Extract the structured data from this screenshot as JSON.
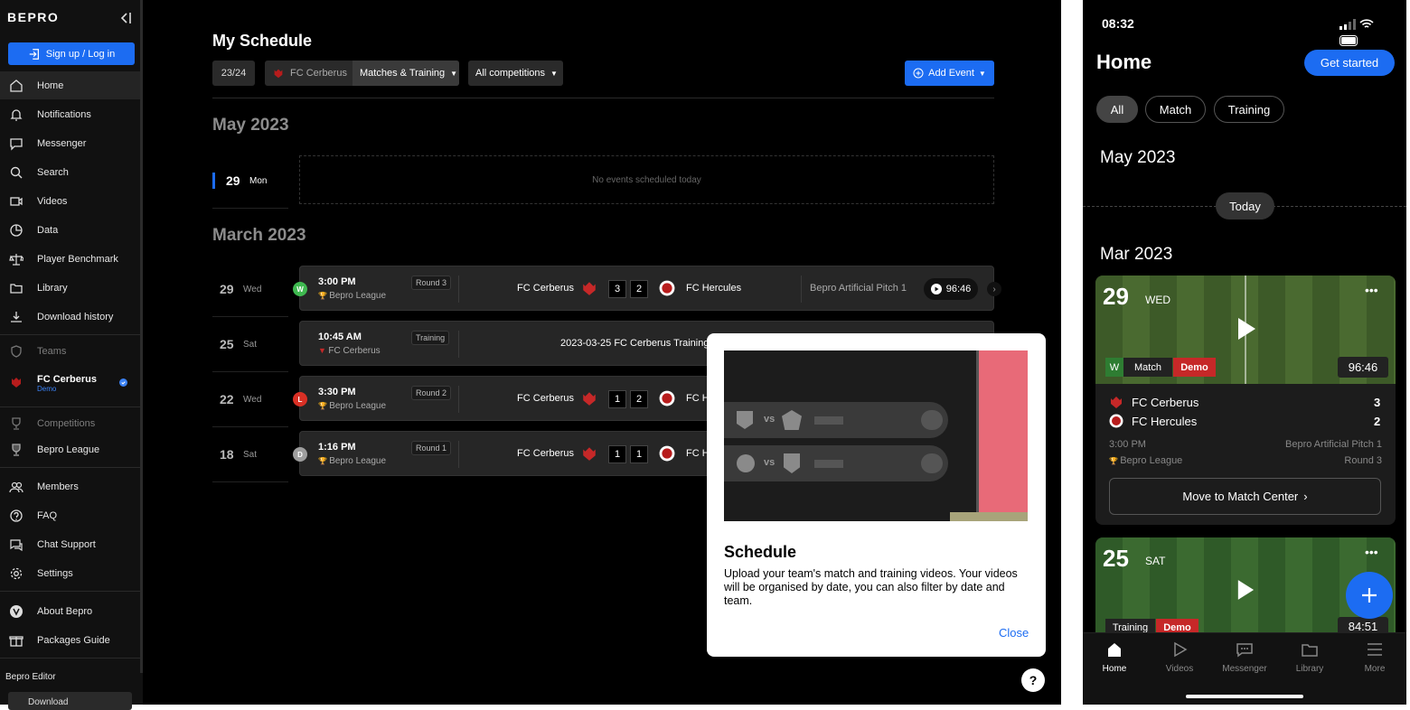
{
  "sidebar": {
    "logo": "BEPRO",
    "signup": "Sign up / Log in",
    "items": [
      {
        "label": "Home"
      },
      {
        "label": "Notifications"
      },
      {
        "label": "Messenger"
      },
      {
        "label": "Search"
      },
      {
        "label": "Videos"
      },
      {
        "label": "Data"
      },
      {
        "label": "Player Benchmark"
      },
      {
        "label": "Library"
      },
      {
        "label": "Download history"
      }
    ],
    "teams_header": "Teams",
    "team_name": "FC Cerberus",
    "team_tag": "Demo",
    "competitions_header": "Competitions",
    "competition": "Bepro League",
    "bottom_items": [
      {
        "label": "Members"
      },
      {
        "label": "FAQ"
      },
      {
        "label": "Chat Support"
      },
      {
        "label": "Settings"
      }
    ],
    "about": "About Bepro",
    "packages": "Packages Guide",
    "editor_header": "Bepro Editor",
    "download": "Download"
  },
  "main": {
    "title": "My Schedule",
    "season": "23/24",
    "team_filter": "FC Cerberus",
    "type_filter": "Matches & Training",
    "comp_filter": "All competitions",
    "add_event": "Add Event",
    "month1": "May 2023",
    "today_day": "29",
    "today_weekday": "Mon",
    "no_events": "No events scheduled today",
    "month2": "March 2023",
    "events": [
      {
        "day": "29",
        "weekday": "Wed",
        "result": "W",
        "time": "3:00 PM",
        "comp": "Bepro League",
        "round": "Round 3",
        "home": "FC Cerberus",
        "hs": "3",
        "as": "2",
        "away": "FC Hercules",
        "venue": "Bepro Artificial Pitch 1",
        "duration": "96:46"
      },
      {
        "day": "25",
        "weekday": "Sat",
        "time": "10:45 AM",
        "comp": "FC Cerberus",
        "round": "Training",
        "title": "2023-03-25 FC Cerberus Training"
      },
      {
        "day": "22",
        "weekday": "Wed",
        "result": "L",
        "time": "3:30 PM",
        "comp": "Bepro League",
        "round": "Round 2",
        "home": "FC Cerberus",
        "hs": "1",
        "as": "2",
        "away": "FC He"
      },
      {
        "day": "18",
        "weekday": "Sat",
        "result": "D",
        "time": "1:16 PM",
        "comp": "Bepro League",
        "round": "Round 1",
        "home": "FC Cerberus",
        "hs": "1",
        "as": "1",
        "away": "FC He"
      }
    ]
  },
  "popup": {
    "vs1": "vs",
    "vs2": "vs",
    "title": "Schedule",
    "body": "Upload your team's match and training videos. Your videos will be organised by date, you can also filter by date and team.",
    "close": "Close"
  },
  "help": "?",
  "phone": {
    "clock": "08:32",
    "title": "Home",
    "cta": "Get started",
    "filters": [
      "All",
      "Match",
      "Training"
    ],
    "month1": "May 2023",
    "today": "Today",
    "month2": "Mar 2023",
    "card1": {
      "day": "29",
      "weekday": "WED",
      "result": "W",
      "type": "Match",
      "tag": "Demo",
      "duration": "96:46",
      "home": "FC Cerberus",
      "hs": "3",
      "away": "FC Hercules",
      "as": "2",
      "time": "3:00 PM",
      "venue": "Bepro Artificial Pitch 1",
      "comp": "Bepro League",
      "round": "Round 3",
      "action": "Move to Match Center"
    },
    "card2": {
      "day": "25",
      "weekday": "SAT",
      "type": "Training",
      "tag": "Demo",
      "duration": "84:51"
    },
    "tabs": [
      "Home",
      "Videos",
      "Messenger",
      "Library",
      "More"
    ]
  },
  "colors": {
    "accent": "#1c6cf2",
    "win": "#3fb950",
    "loss": "#d93025",
    "draw": "#9e9e9e",
    "demo": "#c62828"
  }
}
